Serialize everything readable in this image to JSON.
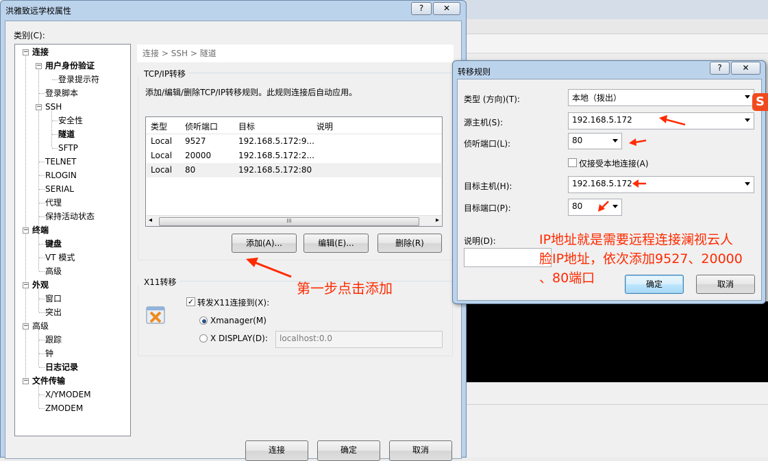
{
  "window": {
    "title": "洪雅致远学校属性",
    "help": "?",
    "close": "✕"
  },
  "category_label": "类别(C):",
  "tree": {
    "connection": "连接",
    "auth": "用户身份验证",
    "login_prompt": "登录提示符",
    "login_script": "登录脚本",
    "ssh": "SSH",
    "security": "安全性",
    "tunnel": "隧道",
    "sftp": "SFTP",
    "telnet": "TELNET",
    "rlogin": "RLOGIN",
    "serial": "SERIAL",
    "proxy": "代理",
    "keepalive": "保持活动状态",
    "terminal": "终端",
    "keyboard": "键盘",
    "vt_mode": "VT 模式",
    "advanced": "高级",
    "appearance": "外观",
    "window": "窗口",
    "highlight": "突出",
    "advanced2": "高级",
    "trace": "跟踪",
    "bell": "钟",
    "log": "日志记录",
    "filetransfer": "文件传输",
    "xymodem": "X/YMODEM",
    "zmodem": "ZMODEM"
  },
  "breadcrumb": {
    "a": "连接",
    "sep1": ">",
    "b": "SSH",
    "sep2": ">",
    "c": "隧道"
  },
  "tcp": {
    "title": "TCP/IP转移",
    "desc": "添加/编辑/删除TCP/IP转移规则。此规则连接后自动应用。",
    "columns": [
      "类型",
      "侦听端口",
      "目标",
      "说明"
    ],
    "rows": [
      [
        "Local",
        "9527",
        "192.168.5.172:9...",
        ""
      ],
      [
        "Local",
        "20000",
        "192.168.5.172:2...",
        ""
      ],
      [
        "Local",
        "80",
        "192.168.5.172:80",
        ""
      ]
    ],
    "scroll_left": "◂",
    "scroll_right": "▸",
    "scroll_grip": "III",
    "add": "添加(A)...",
    "edit": "编辑(E)...",
    "delete": "删除(R)"
  },
  "x11": {
    "title": "X11转移",
    "forward": "转发X11连接到(X):",
    "xmanager": "Xmanager(M)",
    "xdisplay": "X DISPLAY(D):",
    "xdisplay_value": "localhost:0.0"
  },
  "footer": {
    "connect": "连接",
    "ok": "确定",
    "cancel": "取消"
  },
  "rule_dialog": {
    "title": "转移规则",
    "help": "?",
    "close": "✕",
    "type_label": "类型 (方向)(T):",
    "type_value": "本地（拨出）",
    "src_host_label": "源主机(S):",
    "src_host_value": "192.168.5.172",
    "listen_port_label": "侦听端口(L):",
    "listen_port_value": "80",
    "local_only": "仅接受本地连接(A)",
    "dst_host_label": "目标主机(H):",
    "dst_host_value": "192.168.5.172",
    "dst_port_label": "目标端口(P):",
    "dst_port_value": "80",
    "desc_label": "说明(D):",
    "ok": "确定",
    "cancel": "取消"
  },
  "annotations": {
    "step1": "第一步点击添加",
    "ip_line1": "IP地址就是需要远程连接澜视云人",
    "ip_line2": "脸IP地址，依次添加9527、20000",
    "ip_line3": "、80端口"
  },
  "ime_badge": "S",
  "colors": {
    "annotation": "#ff2a00",
    "title_bar": "#bcd3ec",
    "default_button": "#3c7fb1"
  }
}
